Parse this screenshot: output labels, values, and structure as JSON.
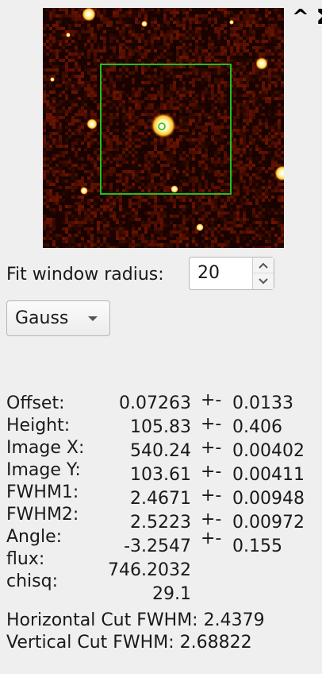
{
  "header": {
    "collapse_label": "^ Σ"
  },
  "fit_window": {
    "label": "Fit window radius:",
    "value": "20"
  },
  "model": {
    "selected": "Gauss"
  },
  "results": {
    "rows": [
      {
        "label": "Offset:",
        "value": "0.07263",
        "plusminus": "+-",
        "error": "0.0133"
      },
      {
        "label": "Height:",
        "value": "105.83",
        "plusminus": "+-",
        "error": "0.406"
      },
      {
        "label": "Image X:",
        "value": "540.24",
        "plusminus": "+-",
        "error": "0.00402"
      },
      {
        "label": "Image Y:",
        "value": "103.61",
        "plusminus": "+-",
        "error": "0.00411"
      },
      {
        "label": "FWHM1:",
        "value": "2.4671",
        "plusminus": "+-",
        "error": "0.00948"
      },
      {
        "label": "FWHM2:",
        "value": "2.5223",
        "plusminus": "+-",
        "error": "0.00972"
      },
      {
        "label": "Angle:",
        "value": "-3.2547",
        "plusminus": "+-",
        "error": "0.155"
      },
      {
        "label": "flux:",
        "value": "746.2032"
      },
      {
        "label": "chisq:",
        "value": "29.1"
      }
    ]
  },
  "cuts": {
    "horizontal": "Horizontal Cut FWHM: 2.4379",
    "vertical": "Vertical Cut FWHM: 2.68822"
  },
  "colors": {
    "stamp_background": "#1a0200",
    "fit_box": "#22c022",
    "star": "#fff4b0",
    "star_halo": "#ffb000"
  }
}
